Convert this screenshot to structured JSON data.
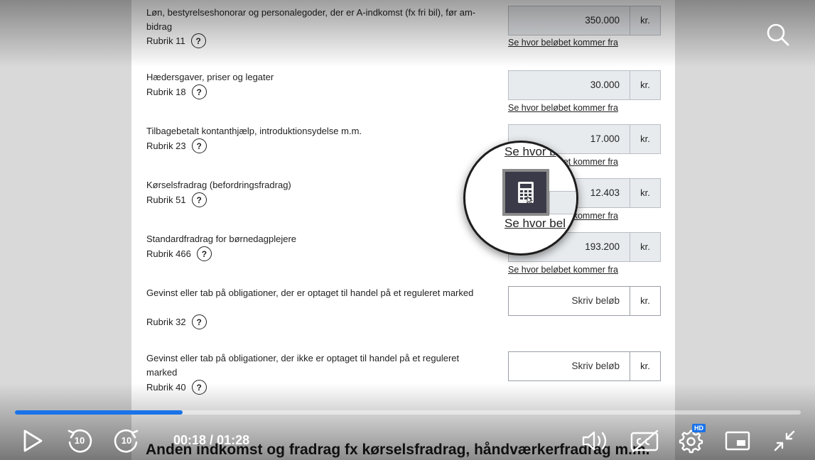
{
  "form_rows": [
    {
      "label": "Løn, bestyrelseshonorar og personalegoder, der er A-indkomst (fx fri bil), før am-bidrag",
      "rubrik": "Rubrik 11",
      "help": "?",
      "value": "350.000",
      "unit": "kr.",
      "link": "Se hvor beløbet kommer fra"
    },
    {
      "label": "Hædersgaver, priser og legater",
      "rubrik": "Rubrik 18",
      "help": "?",
      "value": "30.000",
      "unit": "kr.",
      "link": "Se hvor beløbet kommer fra"
    },
    {
      "label": "Tilbagebetalt kontanthjælp, introduktionsydelse m.m.",
      "rubrik": "Rubrik 23",
      "help": "?",
      "value": "17.000",
      "unit": "kr.",
      "link": "Se hvor beløbet kommer fra"
    },
    {
      "label": "Kørselsfradrag (befordringsfradrag)",
      "rubrik": "Rubrik 51",
      "help": "?",
      "value": "12.403",
      "unit": "kr.",
      "link": "Se hvor beløbet kommer fra"
    },
    {
      "label": "Standardfradrag for børnedagplejere",
      "rubrik": "Rubrik 466",
      "help": "?",
      "value": "193.200",
      "unit": "kr.",
      "link": "Se hvor beløbet kommer fra"
    },
    {
      "label": "Gevinst eller tab på obligationer, der er optaget til handel på et reguleret marked",
      "rubrik": "Rubrik 32",
      "help": "?",
      "placeholder": "Skriv beløb",
      "unit": "kr."
    },
    {
      "label": "Gevinst eller tab på obligationer, der ikke er optaget til handel på et reguleret marked",
      "rubrik": "Rubrik 40",
      "help": "?",
      "placeholder": "Skriv beløb",
      "unit": "kr."
    }
  ],
  "magnifier": {
    "link_top": "Se hvor b",
    "link_bottom": "Se hvor bel",
    "icon": "calculator-icon"
  },
  "section_title": "Anden indkomst og fradrag fx kørselsfradrag, håndværkerfradrag m.m.",
  "player": {
    "time_current": "00:18",
    "time_separator": " / ",
    "time_total": "01:28",
    "progress": 0.213,
    "skip_back_label": "10",
    "skip_forward_label": "10",
    "hd_badge": "HD",
    "accent": "#1a73e8"
  }
}
